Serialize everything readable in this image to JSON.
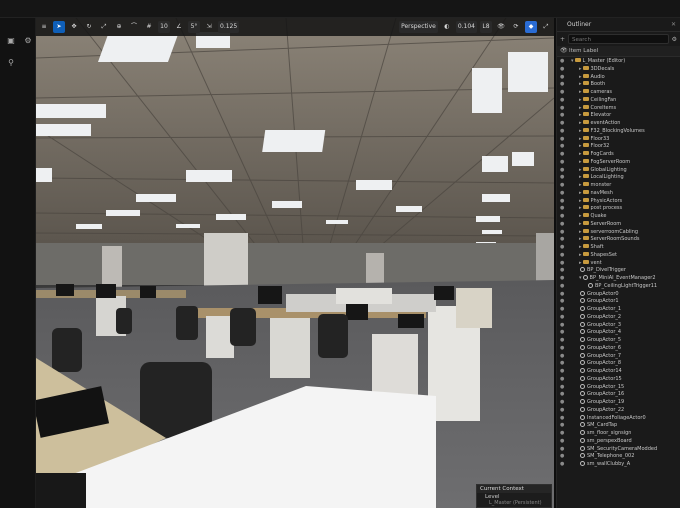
{
  "toolbar": {
    "perspective": "Perspective",
    "grid_value": "10",
    "angle_value": "5°",
    "scale_value": "0.125",
    "camera_speed": "0.104",
    "lighting_label": "L8"
  },
  "outliner": {
    "title": "Outliner",
    "search_placeholder": "Search",
    "column_label": "Item Label",
    "root": "L_Master (Editor)",
    "folders": [
      "3DDecals",
      "Audio",
      "Booth",
      "cameras",
      "CeilingFan",
      "CoreItems",
      "Elevator",
      "eventAction",
      "F32_BlockingVolumes",
      "Floor33",
      "Floor32",
      "FogCards",
      "FogServerRoom",
      "GlobalLighting",
      "LocalLighting",
      "monster",
      "navMesh",
      "PhysicActors",
      "post process",
      "Quake",
      "ServerRoom",
      "serverroomCabling",
      "ServerRoomSounds",
      "Shaft",
      "ShapesSet",
      "vent"
    ],
    "actors_top": [
      "BP_DiveITrigger"
    ],
    "expanded_parent": "BP_MiniAI_EventManager2",
    "expanded_child": "BP_CeilingLightTrigger11",
    "actors": [
      "GroupActor0",
      "GroupActor1",
      "GroupActor_1",
      "GroupActor_2",
      "GroupActor_3",
      "GroupActor_4",
      "GroupActor_5",
      "GroupActor_6",
      "GroupActor_7",
      "GroupActor_8",
      "GroupActor14",
      "GroupActor15",
      "GroupActor_15",
      "GroupActor_16",
      "GroupActor_19",
      "GroupActor_22",
      "InstancedFoliageActor0",
      "SM_CardTap",
      "sm_floor_signsign",
      "sm_perspexBoard",
      "SM_SecurityCameraModded",
      "SM_Telephone_002",
      "sm_wallClubby_A"
    ]
  },
  "context": {
    "title": "Current Context",
    "level": "Level",
    "sub": "L_Master (Persistent)"
  }
}
